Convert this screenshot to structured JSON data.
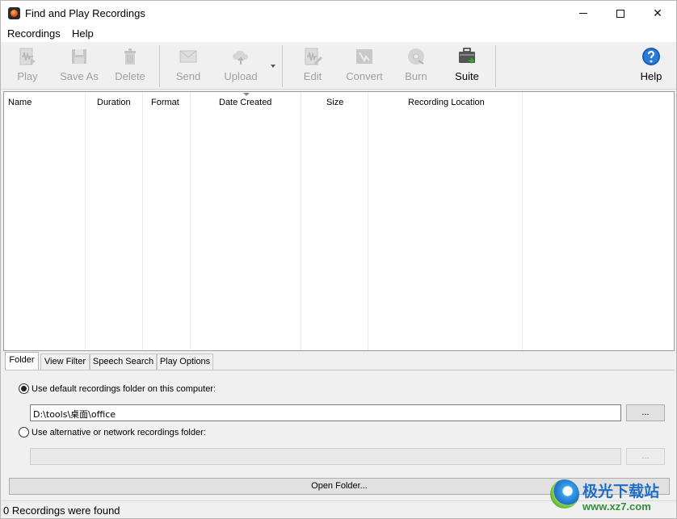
{
  "window": {
    "title": "Find and Play Recordings",
    "close_glyph": "✕"
  },
  "menu": {
    "items": [
      {
        "label": "Recordings"
      },
      {
        "label": "Help"
      }
    ]
  },
  "toolbar": {
    "buttons": [
      {
        "label": "Play",
        "icon": "play-waveform-icon",
        "enabled": false
      },
      {
        "label": "Save As",
        "icon": "floppy-disk-icon",
        "enabled": false
      },
      {
        "label": "Delete",
        "icon": "trash-can-icon",
        "enabled": false
      },
      {
        "label": "Send",
        "icon": "envelope-icon",
        "enabled": false
      },
      {
        "label": "Upload",
        "icon": "cloud-upload-icon",
        "enabled": false
      },
      {
        "label": "Edit",
        "icon": "edit-waveform-icon",
        "enabled": false
      },
      {
        "label": "Convert",
        "icon": "convert-icon",
        "enabled": false
      },
      {
        "label": "Burn",
        "icon": "disc-burn-icon",
        "enabled": false
      },
      {
        "label": "Suite",
        "icon": "suite-briefcase-icon",
        "enabled": true
      },
      {
        "label": "Help",
        "icon": "help-question-icon",
        "enabled": true
      }
    ]
  },
  "list": {
    "columns": [
      "Name",
      "Duration",
      "Format",
      "Date Created",
      "Size",
      "Recording Location"
    ],
    "sorted_column": "Date Created",
    "rows": []
  },
  "tabs": [
    {
      "label": "Folder",
      "active": true
    },
    {
      "label": "View Filter",
      "active": false
    },
    {
      "label": "Speech Search",
      "active": false
    },
    {
      "label": "Play Options",
      "active": false
    }
  ],
  "folder_panel": {
    "default_option_label": "Use default recordings folder on this computer:",
    "default_selected": true,
    "default_path": "D:\\tools\\桌面\\office",
    "alternative_option_label": "Use alternative or network recordings folder:",
    "alternative_path": "",
    "browse_label": "...",
    "open_folder_label": "Open Folder..."
  },
  "status": {
    "text": "0 Recordings were found"
  },
  "watermark": {
    "text": "极光下载站",
    "url": "www.xz7.com"
  }
}
